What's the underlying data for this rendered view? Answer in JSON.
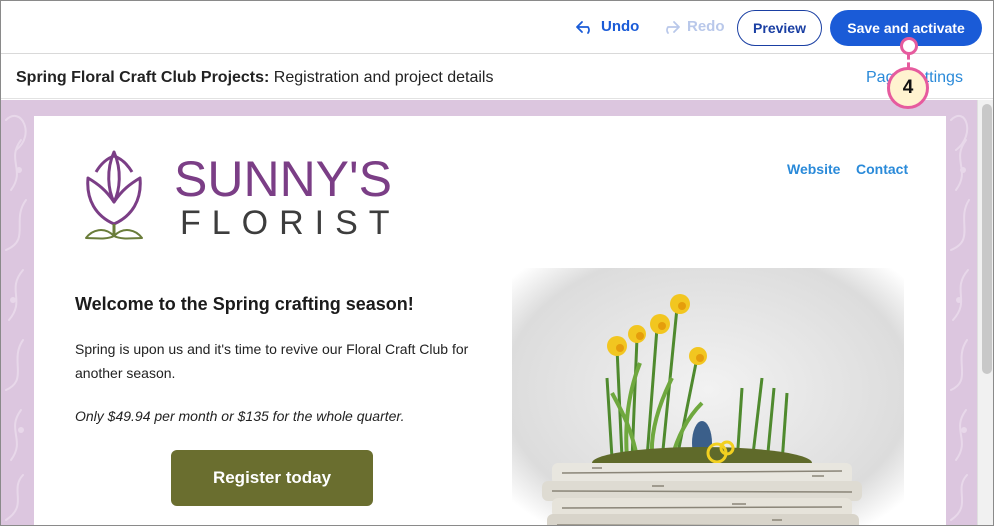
{
  "toolbar": {
    "undo_label": "Undo",
    "redo_label": "Redo",
    "preview_label": "Preview",
    "save_label": "Save and activate"
  },
  "titlebar": {
    "title_bold": "Spring Floral Craft Club Projects:",
    "title_rest": " Registration and project details",
    "page_settings_label": "Page settings"
  },
  "callout": {
    "number": "4"
  },
  "email": {
    "logo": {
      "line1": "SUNNY'S",
      "line2": "FLORIST"
    },
    "nav": {
      "website": "Website",
      "contact": "Contact"
    },
    "headline": "Welcome to the Spring crafting season!",
    "body": "Spring is upon us and it's time to revive our Floral Craft Club for another season.",
    "price": "Only $49.94 per month or $135 for the whole quarter.",
    "register_label": "Register today"
  },
  "colors": {
    "accent": "#1a5bd7",
    "link": "#2a8ad9",
    "canvas_bg": "#dcc6df",
    "brand_purple": "#7b3e86",
    "button_olive": "#6a6e2f",
    "callout": "#e65b9e"
  }
}
